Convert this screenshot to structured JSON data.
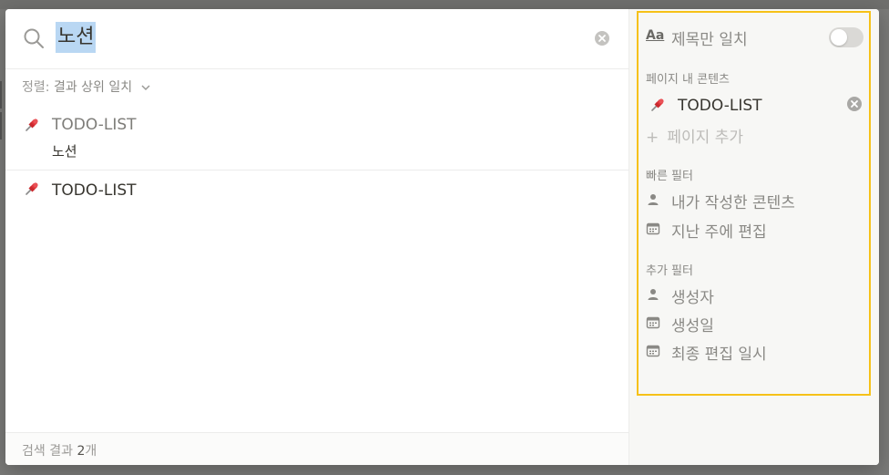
{
  "search": {
    "query": "노션",
    "sort_prefix": "정렬:",
    "sort_value": "결과 상위 일치",
    "results": [
      {
        "title": "TODO-LIST",
        "subtitle": "노션"
      },
      {
        "title": "TODO-LIST"
      }
    ],
    "footer_prefix": "검색 결과",
    "footer_count": "2",
    "footer_suffix": "개"
  },
  "filters": {
    "title_only_icon": "Aa",
    "title_only_label": "제목만 일치",
    "title_only_enabled": false,
    "in_page_label": "페이지 내 콘텐츠",
    "selected_page": "TODO-LIST",
    "add_page_label": "페이지 추가",
    "quick_label": "빠른 필터",
    "quick_items": [
      {
        "label": "내가 작성한 콘텐츠",
        "icon": "person-icon"
      },
      {
        "label": "지난 주에 편집",
        "icon": "calendar-icon"
      }
    ],
    "more_label": "추가 필터",
    "more_items": [
      {
        "label": "생성자",
        "icon": "person-icon"
      },
      {
        "label": "생성일",
        "icon": "calendar-icon"
      },
      {
        "label": "최종 편집 일시",
        "icon": "calendar-icon"
      }
    ]
  },
  "colors": {
    "highlight_border": "#f6c118",
    "selection": "#b9d7f3",
    "pin_red": "#e0353b"
  }
}
